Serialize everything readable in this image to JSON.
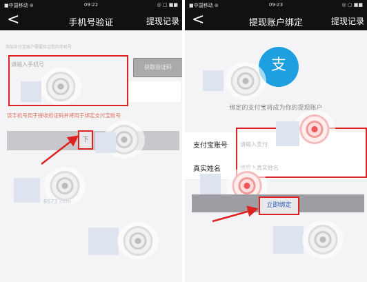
{
  "left": {
    "status": {
      "carrier": "■中国移动 ⊜",
      "time": "09:22",
      "icons": "◎ ▢ ■■"
    },
    "nav": {
      "back": "<",
      "title": "手机号验证",
      "right": "提现记录"
    },
    "hint_top": "添加支付宝账户需要验证您的手机号",
    "phone_placeholder": "请输入手机号",
    "get_code_label": "获取验证码",
    "notice": "该手机号用于接收验证码并将用于绑定支付宝账号",
    "next_label": "下",
    "site_mark": "9573.com"
  },
  "right": {
    "status": {
      "carrier": "■中国移动 ⊜",
      "time": "09:23",
      "icons": "◎ ▢ ■■"
    },
    "nav": {
      "back": "<",
      "title": "提现账户绑定",
      "right": "提现记录"
    },
    "alipay_glyph": "支",
    "bind_text": "绑定的支付宝将成为你的提现账户",
    "alipay_account_label": "支付宝账号",
    "alipay_account_placeholder": "请输入支付",
    "real_name_label": "真实姓名",
    "real_name_placeholder": "请输入真实姓名",
    "bind_button_label": "立即绑定"
  },
  "colors": {
    "annotation_red": "#d22",
    "navbar": "#111",
    "alipay_blue": "#1e9fe0"
  }
}
